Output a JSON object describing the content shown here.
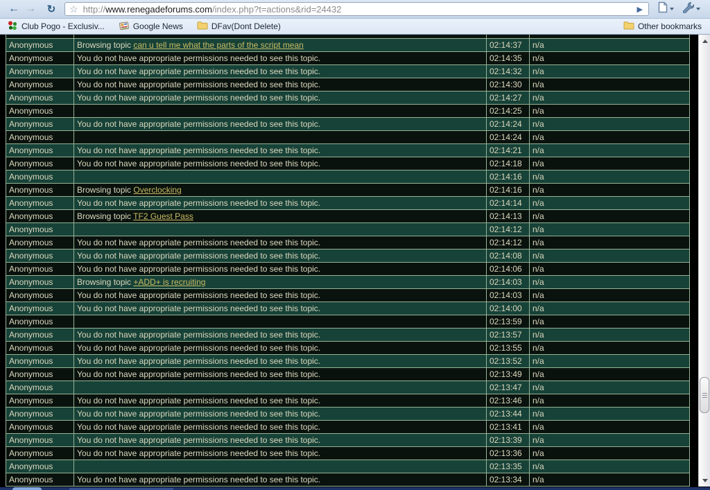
{
  "browser": {
    "toolbar": {
      "back_icon": "left-arrow",
      "forward_icon": "right-arrow",
      "reload_icon": "reload-arrow",
      "star_icon": "bookmark-star",
      "url_scheme": "http://",
      "url_domain": "www.renegadeforums.com",
      "url_path": "/index.php?t=actions&rid=24432",
      "go_icon": "go-triangle"
    },
    "bookmarks": {
      "items": [
        {
          "label": "Club Pogo - Exclusiv...",
          "icon": "club-pogo-favicon"
        },
        {
          "label": "Google News",
          "icon": "google-news-favicon"
        },
        {
          "label": "DFav(Dont Delete)",
          "icon": "folder-icon"
        }
      ],
      "other_label": "Other bookmarks"
    }
  },
  "table": {
    "user": "Anonymous",
    "permission_text": "You do not have appropriate permissions needed to see this topic.",
    "browsing_prefix": "Browsing topic ",
    "na": "n/a",
    "rows": [
      {
        "type": "browse",
        "topic": "can u tell me what the parts of the script mean",
        "time": "02:14:37"
      },
      {
        "type": "perm",
        "time": "02:14:35"
      },
      {
        "type": "perm",
        "time": "02:14:32"
      },
      {
        "type": "perm",
        "time": "02:14:30"
      },
      {
        "type": "perm",
        "time": "02:14:27"
      },
      {
        "type": "none",
        "time": "02:14:25"
      },
      {
        "type": "perm",
        "time": "02:14:24"
      },
      {
        "type": "none",
        "time": "02:14:24"
      },
      {
        "type": "perm",
        "time": "02:14:21"
      },
      {
        "type": "perm",
        "time": "02:14:18"
      },
      {
        "type": "none",
        "time": "02:14:16"
      },
      {
        "type": "browse",
        "topic": "Overclocking",
        "time": "02:14:16"
      },
      {
        "type": "perm",
        "time": "02:14:14"
      },
      {
        "type": "browse",
        "topic": "TF2 Guest Pass",
        "time": "02:14:13"
      },
      {
        "type": "none",
        "time": "02:14:12"
      },
      {
        "type": "perm",
        "time": "02:14:12"
      },
      {
        "type": "perm",
        "time": "02:14:08"
      },
      {
        "type": "perm",
        "time": "02:14:06"
      },
      {
        "type": "browse",
        "topic": "+ADD+ is recruiting",
        "time": "02:14:03"
      },
      {
        "type": "perm",
        "time": "02:14:03"
      },
      {
        "type": "perm",
        "time": "02:14:00"
      },
      {
        "type": "none",
        "time": "02:13:59"
      },
      {
        "type": "perm",
        "time": "02:13:57"
      },
      {
        "type": "perm",
        "time": "02:13:55"
      },
      {
        "type": "perm",
        "time": "02:13:52"
      },
      {
        "type": "perm",
        "time": "02:13:49"
      },
      {
        "type": "none",
        "time": "02:13:47"
      },
      {
        "type": "perm",
        "time": "02:13:46"
      },
      {
        "type": "perm",
        "time": "02:13:44"
      },
      {
        "type": "perm",
        "time": "02:13:41"
      },
      {
        "type": "perm",
        "time": "02:13:39"
      },
      {
        "type": "perm",
        "time": "02:13:36"
      },
      {
        "type": "none",
        "time": "02:13:35"
      },
      {
        "type": "perm",
        "time": "02:13:34"
      }
    ],
    "colors": {
      "row_teal": "#174238",
      "row_dark": "#0a120e",
      "grid_border": "#96b496",
      "text": "#dcd8bd",
      "link": "#c9bc63",
      "page_bg": "#000000"
    }
  }
}
